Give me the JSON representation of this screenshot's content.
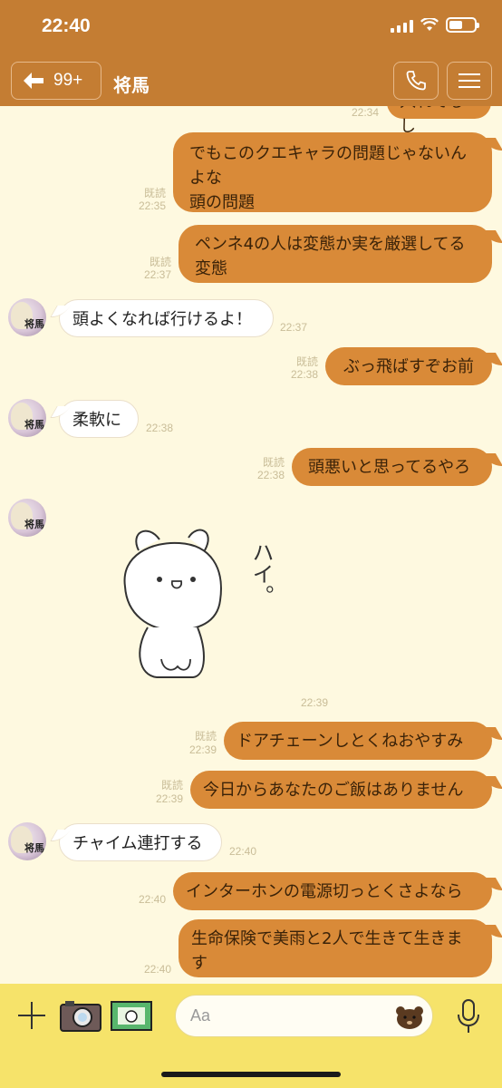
{
  "status": {
    "time": "22:40"
  },
  "header": {
    "back_count": "99+",
    "chat_name": "将馬"
  },
  "messages": {
    "m0": {
      "text": "入れてるし",
      "time": "22:34"
    },
    "m1": {
      "line1": "でもこのクエキャラの問題じゃないん",
      "line2": "よな",
      "line3": "頭の問題",
      "read": "既読",
      "time": "22:35"
    },
    "m2": {
      "line1": "ペンネ4の人は変態か実を厳選してる",
      "line2": "変態",
      "read": "既読",
      "time": "22:37"
    },
    "m3": {
      "text": "頭よくなれば行けるよ！",
      "time": "22:37"
    },
    "m4": {
      "text": "ぶっ飛ばすぞお前",
      "read": "既読",
      "time": "22:38"
    },
    "m5": {
      "text": "柔軟に",
      "time": "22:38"
    },
    "m6": {
      "text": "頭悪いと思ってるやろ",
      "read": "既読",
      "time": "22:38"
    },
    "m7": {
      "sticker_text": "ハイ。",
      "time": "22:39"
    },
    "m8": {
      "text": "ドアチェーンしとくねおやすみ",
      "read": "既読",
      "time": "22:39"
    },
    "m9": {
      "text": "今日からあなたのご飯はありません",
      "read": "既読",
      "time": "22:39"
    },
    "m10": {
      "text": "チャイム連打する",
      "time": "22:40"
    },
    "m11": {
      "text": "インターホンの電源切っとくさよなら",
      "time": "22:40"
    },
    "m12": {
      "line1": "生命保険で美雨と2人で生きて生きま",
      "line2": "す",
      "time": "22:40"
    }
  },
  "avatar_label": "将馬",
  "input": {
    "placeholder": "Aa"
  },
  "colors": {
    "header": "#c47d33",
    "background": "#fef9e0",
    "bubble_out": "#d98a38",
    "input_bar": "#f6e36a"
  },
  "icons": [
    "back-arrow-icon",
    "phone-icon",
    "menu-icon",
    "plus-icon",
    "camera-icon",
    "image-icon",
    "bear-emoji-icon",
    "microphone-icon"
  ]
}
